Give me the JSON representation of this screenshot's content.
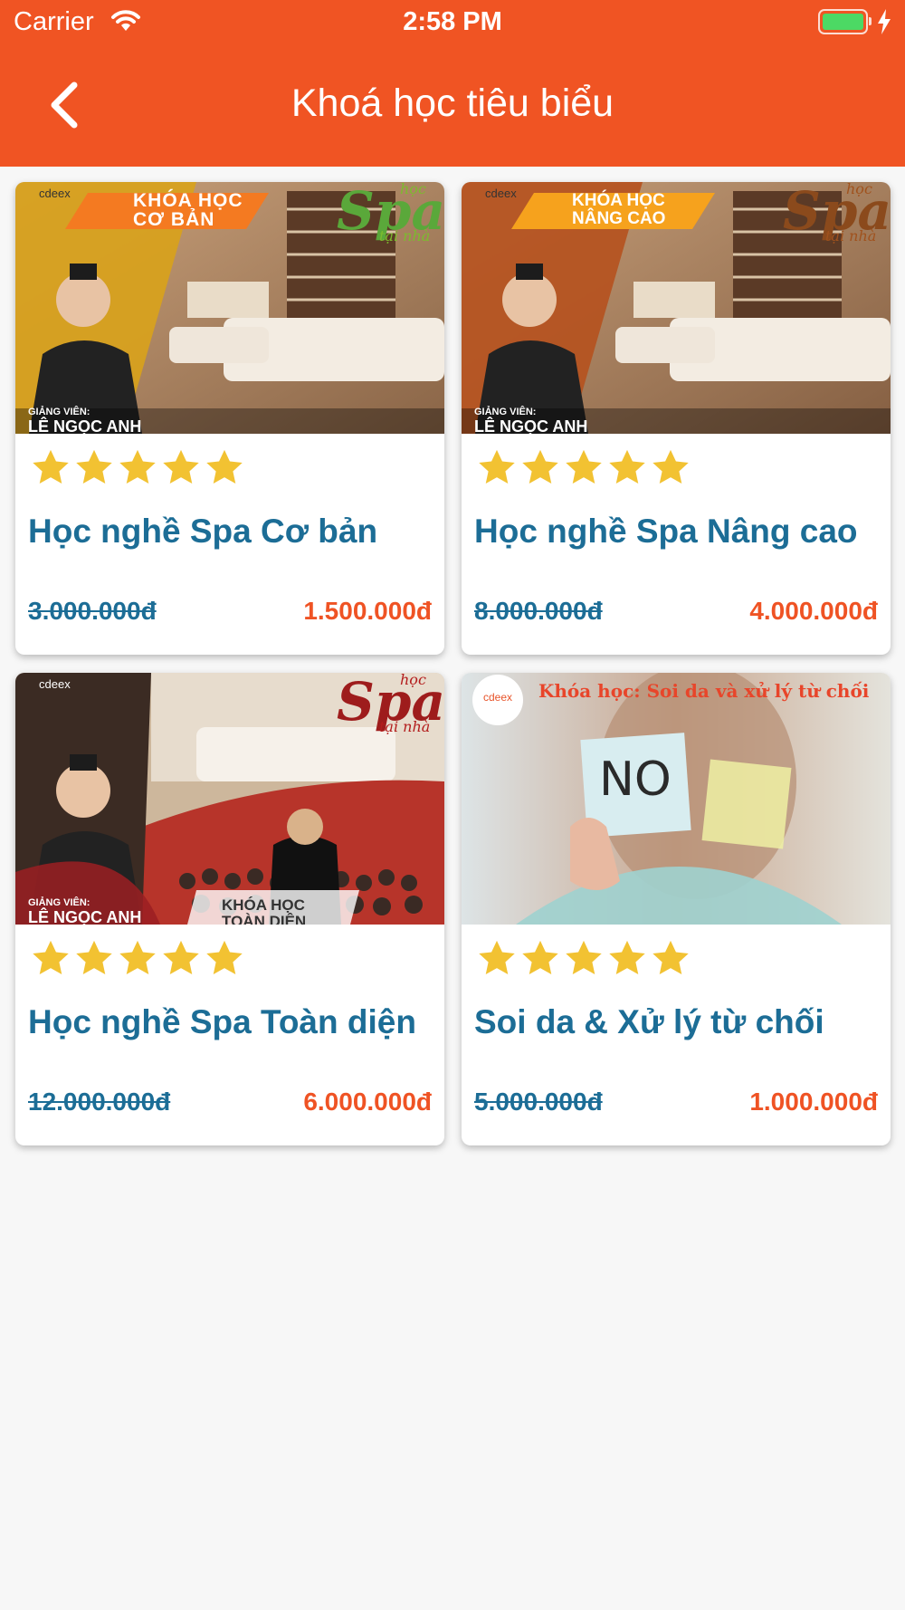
{
  "status_bar": {
    "carrier": "Carrier",
    "time": "2:58 PM"
  },
  "header": {
    "title": "Khoá học tiêu biểu"
  },
  "colors": {
    "header": "#f05423",
    "title_blue": "#1c6d96",
    "price_orange": "#ef5324",
    "star": "#f2c232"
  },
  "courses": [
    {
      "title": "Học nghề Spa Cơ bản",
      "old_price": "3.000.000đ",
      "new_price": "1.500.000đ",
      "rating": 5,
      "banner": {
        "badge_line1": "KHÓA HỌC",
        "badge_line2": "CƠ BẢN",
        "spa_word": "Spa",
        "spa_top": "học",
        "spa_bottom": "tại nhà",
        "lecturer_label": "GIẢNG VIÊN:",
        "lecturer_name": "LÊ NGỌC ANH",
        "logo": "cdeex"
      }
    },
    {
      "title": "Học nghề Spa Nâng cao",
      "old_price": "8.000.000đ",
      "new_price": "4.000.000đ",
      "rating": 5,
      "banner": {
        "badge_line1": "KHÓA HỌC",
        "badge_line2": "NÂNG CAO",
        "spa_word": "Spa",
        "spa_top": "học",
        "spa_bottom": "tại nhà",
        "lecturer_label": "GIẢNG VIÊN:",
        "lecturer_name": "LÊ NGỌC ANH",
        "logo": "cdeex"
      }
    },
    {
      "title": "Học nghề Spa Toàn diện",
      "old_price": "12.000.000đ",
      "new_price": "6.000.000đ",
      "rating": 5,
      "banner": {
        "badge_line1": "KHÓA HỌC",
        "badge_line2": "TOÀN DIỆN",
        "spa_word": "Spa",
        "spa_top": "học",
        "spa_bottom": "tại nhà",
        "lecturer_label": "GIẢNG VIÊN:",
        "lecturer_name": "LÊ NGỌC ANH",
        "logo": "cdeex"
      }
    },
    {
      "title": "Soi da & Xử lý từ chối",
      "old_price": "5.000.000đ",
      "new_price": "1.000.000đ",
      "rating": 5,
      "banner": {
        "headline": "Khóa học: Soi da và xử lý từ chối",
        "note_text": "NO",
        "logo": "cdeex"
      }
    }
  ]
}
